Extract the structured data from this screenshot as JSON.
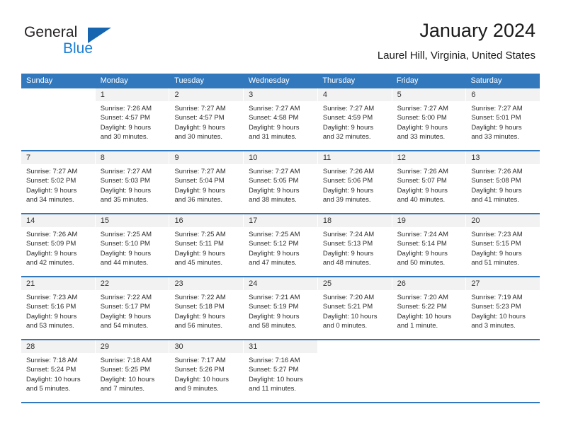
{
  "brand": {
    "name_part1": "General",
    "name_part2": "Blue",
    "accent_color": "#1565b0",
    "link_color": "#1a7fd4"
  },
  "header": {
    "title": "January 2024",
    "subtitle": "Laurel Hill, Virginia, United States"
  },
  "calendar": {
    "header_bg": "#3278bd",
    "daynum_bg": "#f2f2f2",
    "weekdays": [
      "Sunday",
      "Monday",
      "Tuesday",
      "Wednesday",
      "Thursday",
      "Friday",
      "Saturday"
    ],
    "weeks": [
      [
        {
          "day": "",
          "sunrise": "",
          "sunset": "",
          "daylight": "",
          "daylight2": ""
        },
        {
          "day": "1",
          "sunrise": "Sunrise: 7:26 AM",
          "sunset": "Sunset: 4:57 PM",
          "daylight": "Daylight: 9 hours",
          "daylight2": "and 30 minutes."
        },
        {
          "day": "2",
          "sunrise": "Sunrise: 7:27 AM",
          "sunset": "Sunset: 4:57 PM",
          "daylight": "Daylight: 9 hours",
          "daylight2": "and 30 minutes."
        },
        {
          "day": "3",
          "sunrise": "Sunrise: 7:27 AM",
          "sunset": "Sunset: 4:58 PM",
          "daylight": "Daylight: 9 hours",
          "daylight2": "and 31 minutes."
        },
        {
          "day": "4",
          "sunrise": "Sunrise: 7:27 AM",
          "sunset": "Sunset: 4:59 PM",
          "daylight": "Daylight: 9 hours",
          "daylight2": "and 32 minutes."
        },
        {
          "day": "5",
          "sunrise": "Sunrise: 7:27 AM",
          "sunset": "Sunset: 5:00 PM",
          "daylight": "Daylight: 9 hours",
          "daylight2": "and 33 minutes."
        },
        {
          "day": "6",
          "sunrise": "Sunrise: 7:27 AM",
          "sunset": "Sunset: 5:01 PM",
          "daylight": "Daylight: 9 hours",
          "daylight2": "and 33 minutes."
        }
      ],
      [
        {
          "day": "7",
          "sunrise": "Sunrise: 7:27 AM",
          "sunset": "Sunset: 5:02 PM",
          "daylight": "Daylight: 9 hours",
          "daylight2": "and 34 minutes."
        },
        {
          "day": "8",
          "sunrise": "Sunrise: 7:27 AM",
          "sunset": "Sunset: 5:03 PM",
          "daylight": "Daylight: 9 hours",
          "daylight2": "and 35 minutes."
        },
        {
          "day": "9",
          "sunrise": "Sunrise: 7:27 AM",
          "sunset": "Sunset: 5:04 PM",
          "daylight": "Daylight: 9 hours",
          "daylight2": "and 36 minutes."
        },
        {
          "day": "10",
          "sunrise": "Sunrise: 7:27 AM",
          "sunset": "Sunset: 5:05 PM",
          "daylight": "Daylight: 9 hours",
          "daylight2": "and 38 minutes."
        },
        {
          "day": "11",
          "sunrise": "Sunrise: 7:26 AM",
          "sunset": "Sunset: 5:06 PM",
          "daylight": "Daylight: 9 hours",
          "daylight2": "and 39 minutes."
        },
        {
          "day": "12",
          "sunrise": "Sunrise: 7:26 AM",
          "sunset": "Sunset: 5:07 PM",
          "daylight": "Daylight: 9 hours",
          "daylight2": "and 40 minutes."
        },
        {
          "day": "13",
          "sunrise": "Sunrise: 7:26 AM",
          "sunset": "Sunset: 5:08 PM",
          "daylight": "Daylight: 9 hours",
          "daylight2": "and 41 minutes."
        }
      ],
      [
        {
          "day": "14",
          "sunrise": "Sunrise: 7:26 AM",
          "sunset": "Sunset: 5:09 PM",
          "daylight": "Daylight: 9 hours",
          "daylight2": "and 42 minutes."
        },
        {
          "day": "15",
          "sunrise": "Sunrise: 7:25 AM",
          "sunset": "Sunset: 5:10 PM",
          "daylight": "Daylight: 9 hours",
          "daylight2": "and 44 minutes."
        },
        {
          "day": "16",
          "sunrise": "Sunrise: 7:25 AM",
          "sunset": "Sunset: 5:11 PM",
          "daylight": "Daylight: 9 hours",
          "daylight2": "and 45 minutes."
        },
        {
          "day": "17",
          "sunrise": "Sunrise: 7:25 AM",
          "sunset": "Sunset: 5:12 PM",
          "daylight": "Daylight: 9 hours",
          "daylight2": "and 47 minutes."
        },
        {
          "day": "18",
          "sunrise": "Sunrise: 7:24 AM",
          "sunset": "Sunset: 5:13 PM",
          "daylight": "Daylight: 9 hours",
          "daylight2": "and 48 minutes."
        },
        {
          "day": "19",
          "sunrise": "Sunrise: 7:24 AM",
          "sunset": "Sunset: 5:14 PM",
          "daylight": "Daylight: 9 hours",
          "daylight2": "and 50 minutes."
        },
        {
          "day": "20",
          "sunrise": "Sunrise: 7:23 AM",
          "sunset": "Sunset: 5:15 PM",
          "daylight": "Daylight: 9 hours",
          "daylight2": "and 51 minutes."
        }
      ],
      [
        {
          "day": "21",
          "sunrise": "Sunrise: 7:23 AM",
          "sunset": "Sunset: 5:16 PM",
          "daylight": "Daylight: 9 hours",
          "daylight2": "and 53 minutes."
        },
        {
          "day": "22",
          "sunrise": "Sunrise: 7:22 AM",
          "sunset": "Sunset: 5:17 PM",
          "daylight": "Daylight: 9 hours",
          "daylight2": "and 54 minutes."
        },
        {
          "day": "23",
          "sunrise": "Sunrise: 7:22 AM",
          "sunset": "Sunset: 5:18 PM",
          "daylight": "Daylight: 9 hours",
          "daylight2": "and 56 minutes."
        },
        {
          "day": "24",
          "sunrise": "Sunrise: 7:21 AM",
          "sunset": "Sunset: 5:19 PM",
          "daylight": "Daylight: 9 hours",
          "daylight2": "and 58 minutes."
        },
        {
          "day": "25",
          "sunrise": "Sunrise: 7:20 AM",
          "sunset": "Sunset: 5:21 PM",
          "daylight": "Daylight: 10 hours",
          "daylight2": "and 0 minutes."
        },
        {
          "day": "26",
          "sunrise": "Sunrise: 7:20 AM",
          "sunset": "Sunset: 5:22 PM",
          "daylight": "Daylight: 10 hours",
          "daylight2": "and 1 minute."
        },
        {
          "day": "27",
          "sunrise": "Sunrise: 7:19 AM",
          "sunset": "Sunset: 5:23 PM",
          "daylight": "Daylight: 10 hours",
          "daylight2": "and 3 minutes."
        }
      ],
      [
        {
          "day": "28",
          "sunrise": "Sunrise: 7:18 AM",
          "sunset": "Sunset: 5:24 PM",
          "daylight": "Daylight: 10 hours",
          "daylight2": "and 5 minutes."
        },
        {
          "day": "29",
          "sunrise": "Sunrise: 7:18 AM",
          "sunset": "Sunset: 5:25 PM",
          "daylight": "Daylight: 10 hours",
          "daylight2": "and 7 minutes."
        },
        {
          "day": "30",
          "sunrise": "Sunrise: 7:17 AM",
          "sunset": "Sunset: 5:26 PM",
          "daylight": "Daylight: 10 hours",
          "daylight2": "and 9 minutes."
        },
        {
          "day": "31",
          "sunrise": "Sunrise: 7:16 AM",
          "sunset": "Sunset: 5:27 PM",
          "daylight": "Daylight: 10 hours",
          "daylight2": "and 11 minutes."
        },
        {
          "day": "",
          "sunrise": "",
          "sunset": "",
          "daylight": "",
          "daylight2": ""
        },
        {
          "day": "",
          "sunrise": "",
          "sunset": "",
          "daylight": "",
          "daylight2": ""
        },
        {
          "day": "",
          "sunrise": "",
          "sunset": "",
          "daylight": "",
          "daylight2": ""
        }
      ]
    ]
  }
}
